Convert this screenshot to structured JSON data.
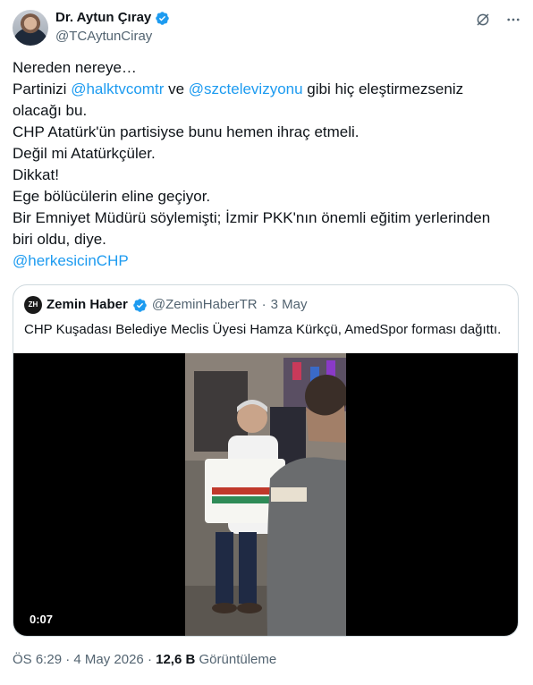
{
  "author": {
    "display_name": "Dr. Aytun Çıray",
    "handle": "@TCAytunCiray"
  },
  "tweet": {
    "lines": [
      [
        {
          "t": "Nereden nereye…"
        }
      ],
      [
        {
          "t": "Partinizi "
        },
        {
          "t": "@halktvcomtr",
          "m": true
        },
        {
          "t": " ve "
        },
        {
          "t": "@szctelevizyonu",
          "m": true
        },
        {
          "t": " gibi hiç eleştirmezseniz"
        }
      ],
      [
        {
          "t": "olacağı bu."
        }
      ],
      [
        {
          "t": "CHP Atatürk'ün partisiyse bunu hemen ihraç etmeli."
        }
      ],
      [
        {
          "t": "Değil mi Atatürkçüler."
        }
      ],
      [
        {
          "t": "Dikkat!"
        }
      ],
      [
        {
          "t": "Ege bölücülerin eline geçiyor."
        }
      ],
      [
        {
          "t": "Bir Emniyet Müdürü söylemişti; İzmir PKK'nın önemli eğitim yerlerinden"
        }
      ],
      [
        {
          "t": "biri oldu, diye."
        }
      ],
      [
        {
          "t": "@herkesicinCHP",
          "m": true
        }
      ]
    ]
  },
  "quote": {
    "avatar_text": "ZH",
    "display_name": "Zemin Haber",
    "handle": "@ZeminHaberTR",
    "separator": "·",
    "date": "3 May",
    "text": "CHP Kuşadası Belediye Meclis Üyesi Hamza Kürkçü, AmedSpor forması dağıttı.",
    "video_duration": "0:07"
  },
  "meta": {
    "time": "ÖS 6:29",
    "separator1": "·",
    "date": "4 May 2026",
    "separator2": "·",
    "views_count": "12,6 B",
    "views_label": "Görüntüleme"
  },
  "icons": {
    "verified": "verified-badge-icon",
    "grok": "grok-icon",
    "more": "more-icon"
  },
  "colors": {
    "accent": "#1d9bf0",
    "muted": "#536471",
    "text": "#0f1419",
    "border": "#cfd9de"
  }
}
